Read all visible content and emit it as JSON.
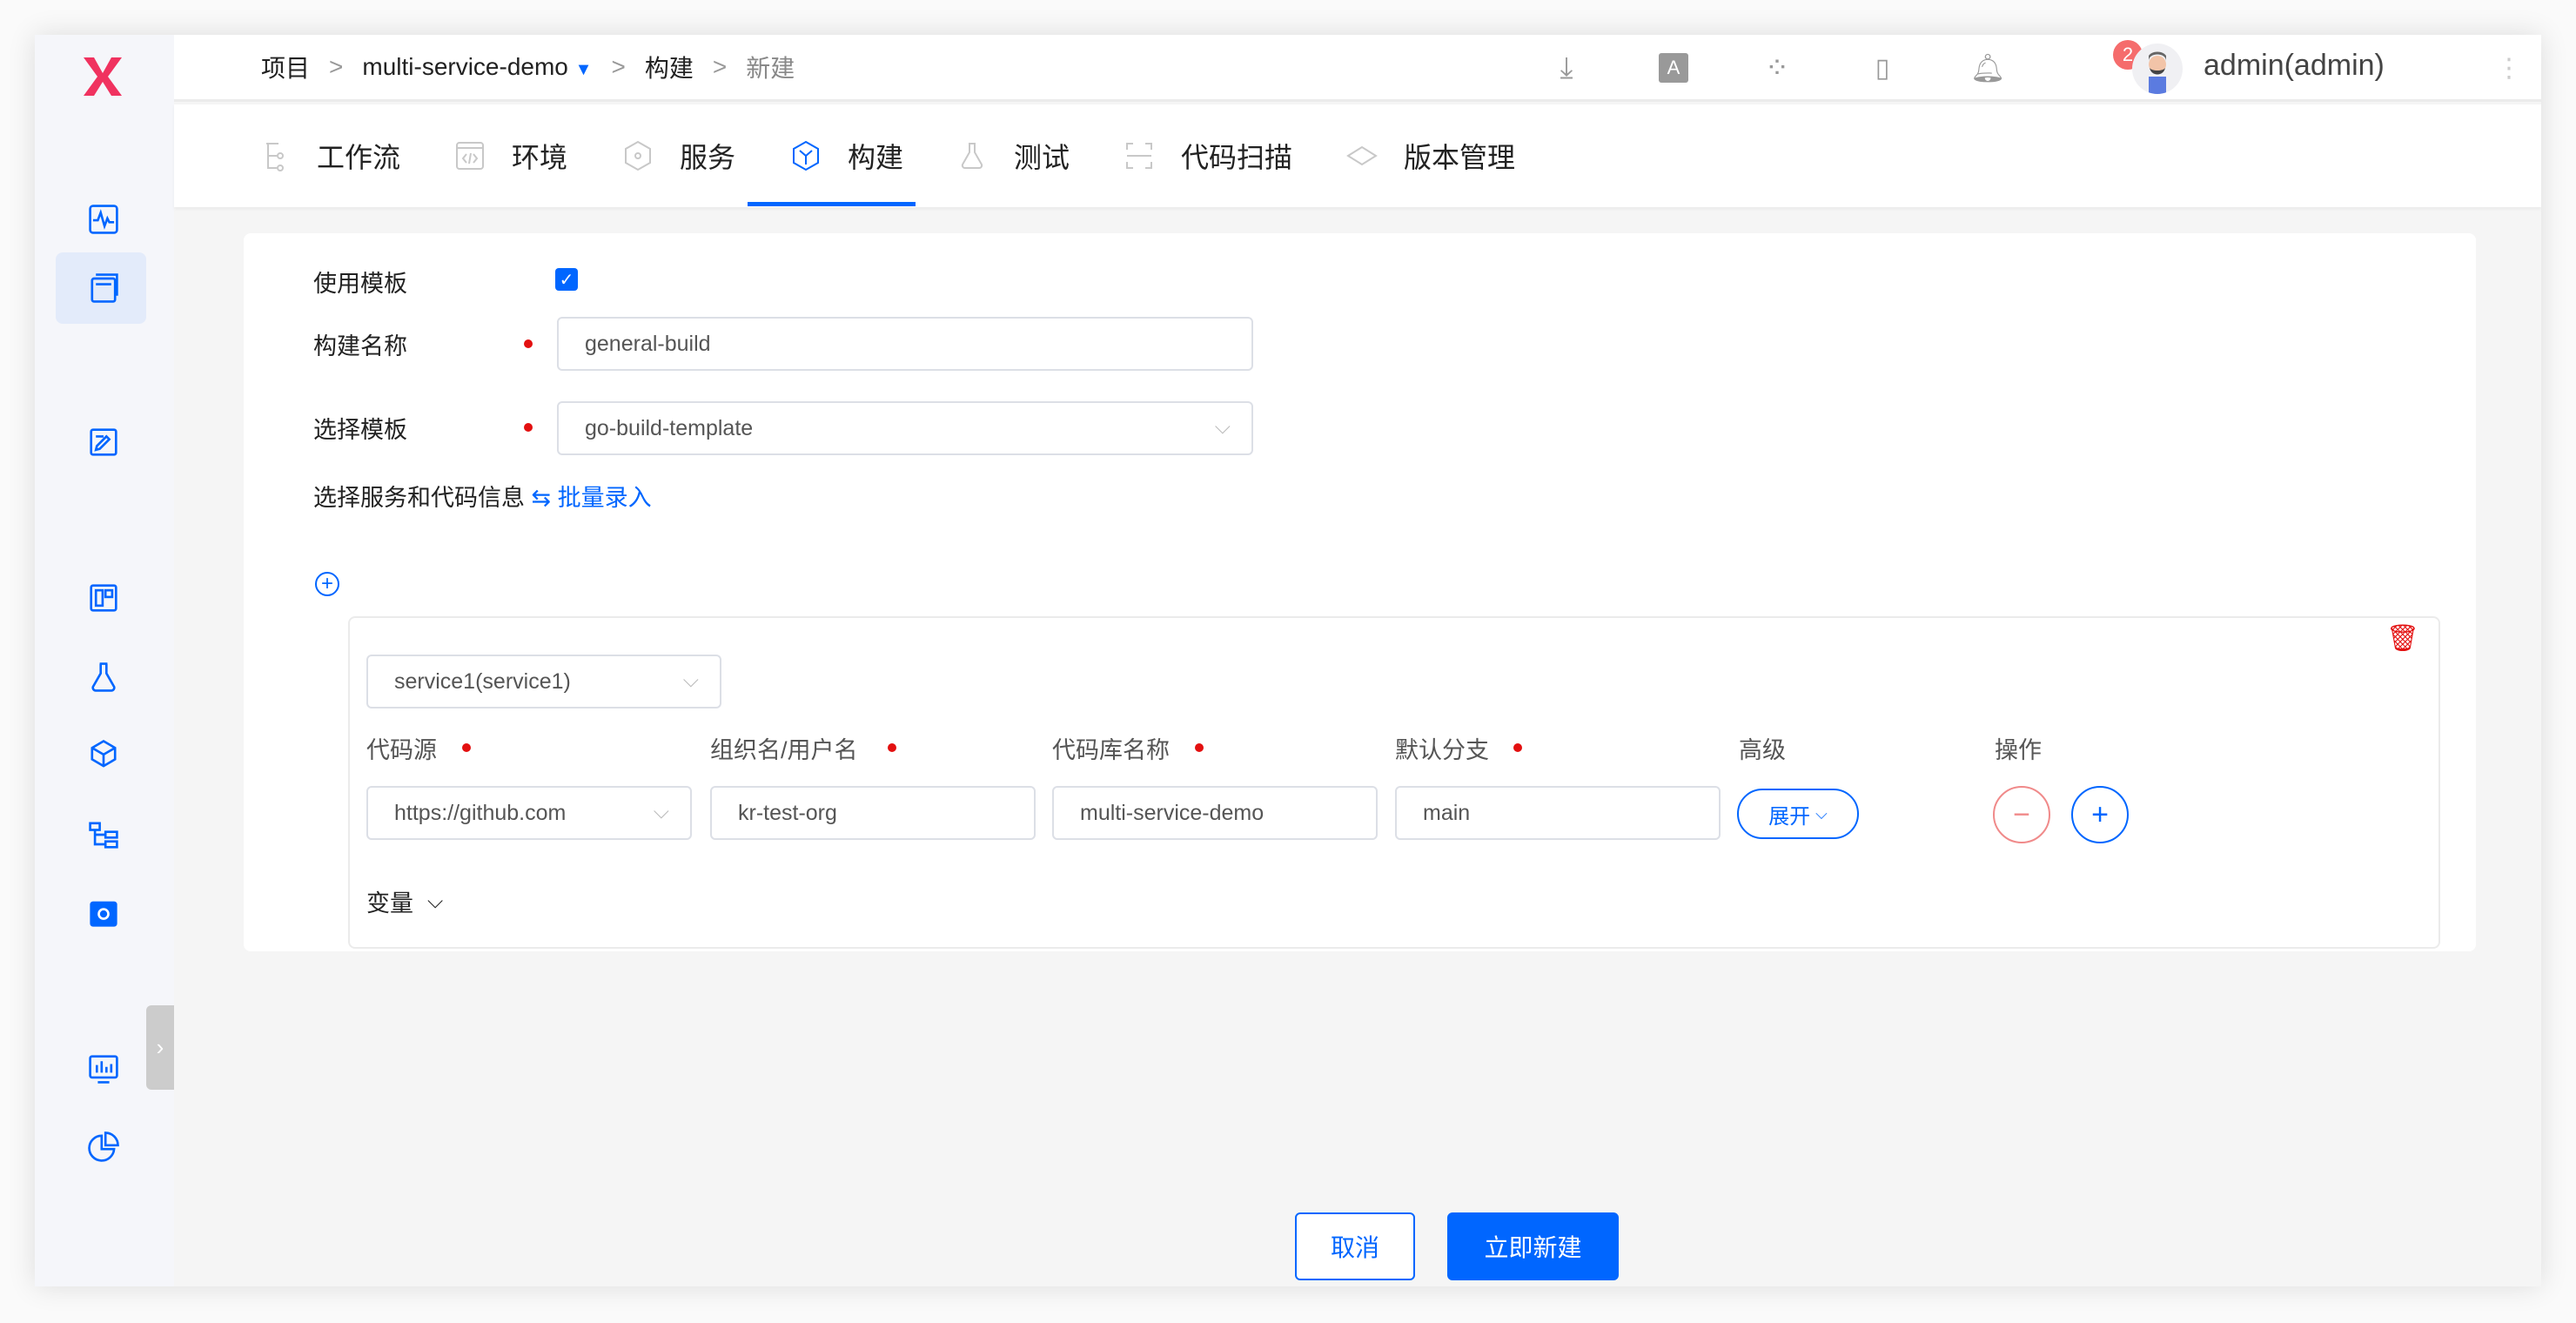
{
  "breadcrumb": {
    "root": "项目",
    "project": "multi-service-demo",
    "section": "构建",
    "current": "新建",
    "separator": ">"
  },
  "header": {
    "notification_count": "2",
    "user": "admin(admin)"
  },
  "tabs": [
    {
      "label": "工作流"
    },
    {
      "label": "环境"
    },
    {
      "label": "服务"
    },
    {
      "label": "构建",
      "active": true
    },
    {
      "label": "测试"
    },
    {
      "label": "代码扫描"
    },
    {
      "label": "版本管理"
    }
  ],
  "form": {
    "use_template_label": "使用模板",
    "use_template_checked": true,
    "build_name_label": "构建名称",
    "build_name_value": "general-build",
    "template_label": "选择模板",
    "template_value": "go-build-template",
    "service_info_label": "选择服务和代码信息",
    "batch_label": "⇆ 批量录入",
    "service_value": "service1(service1)",
    "columns": {
      "source": "代码源",
      "org": "组织名/用户名",
      "repo": "代码库名称",
      "branch": "默认分支",
      "advanced": "高级",
      "ops": "操作"
    },
    "row": {
      "source": "https://github.com",
      "org": "kr-test-org",
      "repo": "multi-service-demo",
      "branch": "main",
      "expand": "展开"
    },
    "variables_label": "变量"
  },
  "actions": {
    "cancel": "取消",
    "create": "立即新建"
  },
  "colors": {
    "primary": "#0066ff",
    "danger": "#e31010",
    "logo": "#f0325f"
  }
}
